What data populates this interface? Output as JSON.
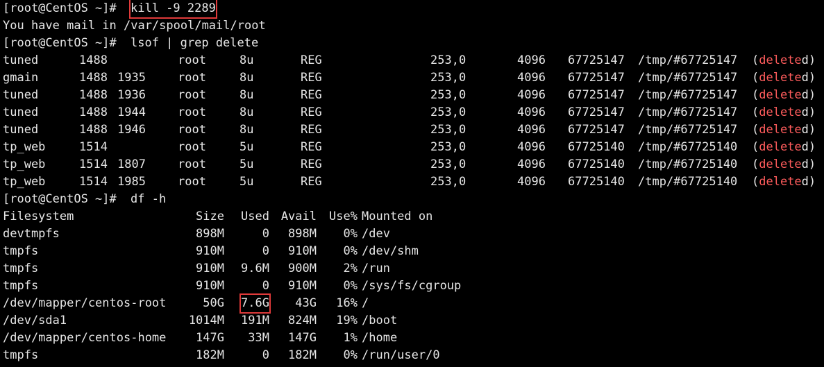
{
  "colors": {
    "background": "#000000",
    "foreground": "#e6e6e6",
    "deleted_highlight": "#ff5c5c",
    "annotation_box": "#e03a3a"
  },
  "prompt1": {
    "prompt": "[root@CentOS ~]# ",
    "command": "kill -9 2289"
  },
  "mail_notice": "You have mail in /var/spool/mail/root",
  "prompt2": {
    "prompt": "[root@CentOS ~]# ",
    "command": "lsof | grep delete"
  },
  "lsof_rows": [
    {
      "cmd": "tuned",
      "pid": "1488",
      "tid": "",
      "user": "root",
      "fd": "8u",
      "type": "REG",
      "device": "253,0",
      "size": "4096",
      "node": "67725147",
      "name": "/tmp/#67725147",
      "open": "(",
      "del": "delete",
      "close": "d)"
    },
    {
      "cmd": "gmain",
      "pid": "1488",
      "tid": "1935",
      "user": "root",
      "fd": "8u",
      "type": "REG",
      "device": "253,0",
      "size": "4096",
      "node": "67725147",
      "name": "/tmp/#67725147",
      "open": "(",
      "del": "delete",
      "close": "d)"
    },
    {
      "cmd": "tuned",
      "pid": "1488",
      "tid": "1936",
      "user": "root",
      "fd": "8u",
      "type": "REG",
      "device": "253,0",
      "size": "4096",
      "node": "67725147",
      "name": "/tmp/#67725147",
      "open": "(",
      "del": "delete",
      "close": "d)"
    },
    {
      "cmd": "tuned",
      "pid": "1488",
      "tid": "1944",
      "user": "root",
      "fd": "8u",
      "type": "REG",
      "device": "253,0",
      "size": "4096",
      "node": "67725147",
      "name": "/tmp/#67725147",
      "open": "(",
      "del": "delete",
      "close": "d)"
    },
    {
      "cmd": "tuned",
      "pid": "1488",
      "tid": "1946",
      "user": "root",
      "fd": "8u",
      "type": "REG",
      "device": "253,0",
      "size": "4096",
      "node": "67725147",
      "name": "/tmp/#67725147",
      "open": "(",
      "del": "delete",
      "close": "d)"
    },
    {
      "cmd": "tp_web",
      "pid": "1514",
      "tid": "",
      "user": "root",
      "fd": "5u",
      "type": "REG",
      "device": "253,0",
      "size": "4096",
      "node": "67725140",
      "name": "/tmp/#67725140",
      "open": "(",
      "del": "delete",
      "close": "d)"
    },
    {
      "cmd": "tp_web",
      "pid": "1514",
      "tid": "1807",
      "user": "root",
      "fd": "5u",
      "type": "REG",
      "device": "253,0",
      "size": "4096",
      "node": "67725140",
      "name": "/tmp/#67725140",
      "open": "(",
      "del": "delete",
      "close": "d)"
    },
    {
      "cmd": "tp_web",
      "pid": "1514",
      "tid": "1985",
      "user": "root",
      "fd": "5u",
      "type": "REG",
      "device": "253,0",
      "size": "4096",
      "node": "67725140",
      "name": "/tmp/#67725140",
      "open": "(",
      "del": "delete",
      "close": "d)"
    }
  ],
  "prompt3": {
    "prompt": "[root@CentOS ~]# ",
    "command": "df -h"
  },
  "df_header": {
    "filesystem": "Filesystem",
    "size": "Size",
    "used": "Used",
    "avail": "Avail",
    "usep": "Use%",
    "mounted": "Mounted on"
  },
  "df_rows": [
    {
      "filesystem": "devtmpfs",
      "size": "898M",
      "used": "0",
      "avail": "898M",
      "usep": "0%",
      "mounted": "/dev"
    },
    {
      "filesystem": "tmpfs",
      "size": "910M",
      "used": "0",
      "avail": "910M",
      "usep": "0%",
      "mounted": "/dev/shm"
    },
    {
      "filesystem": "tmpfs",
      "size": "910M",
      "used": "9.6M",
      "avail": "900M",
      "usep": "2%",
      "mounted": "/run"
    },
    {
      "filesystem": "tmpfs",
      "size": "910M",
      "used": "0",
      "avail": "910M",
      "usep": "0%",
      "mounted": "/sys/fs/cgroup"
    },
    {
      "filesystem": "/dev/mapper/centos-root",
      "size": "50G",
      "used": "7.6G",
      "avail": "43G",
      "usep": "16%",
      "mounted": "/",
      "highlight_used": true
    },
    {
      "filesystem": "/dev/sda1",
      "size": "1014M",
      "used": "191M",
      "avail": "824M",
      "usep": "19%",
      "mounted": "/boot"
    },
    {
      "filesystem": "/dev/mapper/centos-home",
      "size": "147G",
      "used": "33M",
      "avail": "147G",
      "usep": "1%",
      "mounted": "/home"
    },
    {
      "filesystem": "tmpfs",
      "size": "182M",
      "used": "0",
      "avail": "182M",
      "usep": "0%",
      "mounted": "/run/user/0"
    }
  ]
}
